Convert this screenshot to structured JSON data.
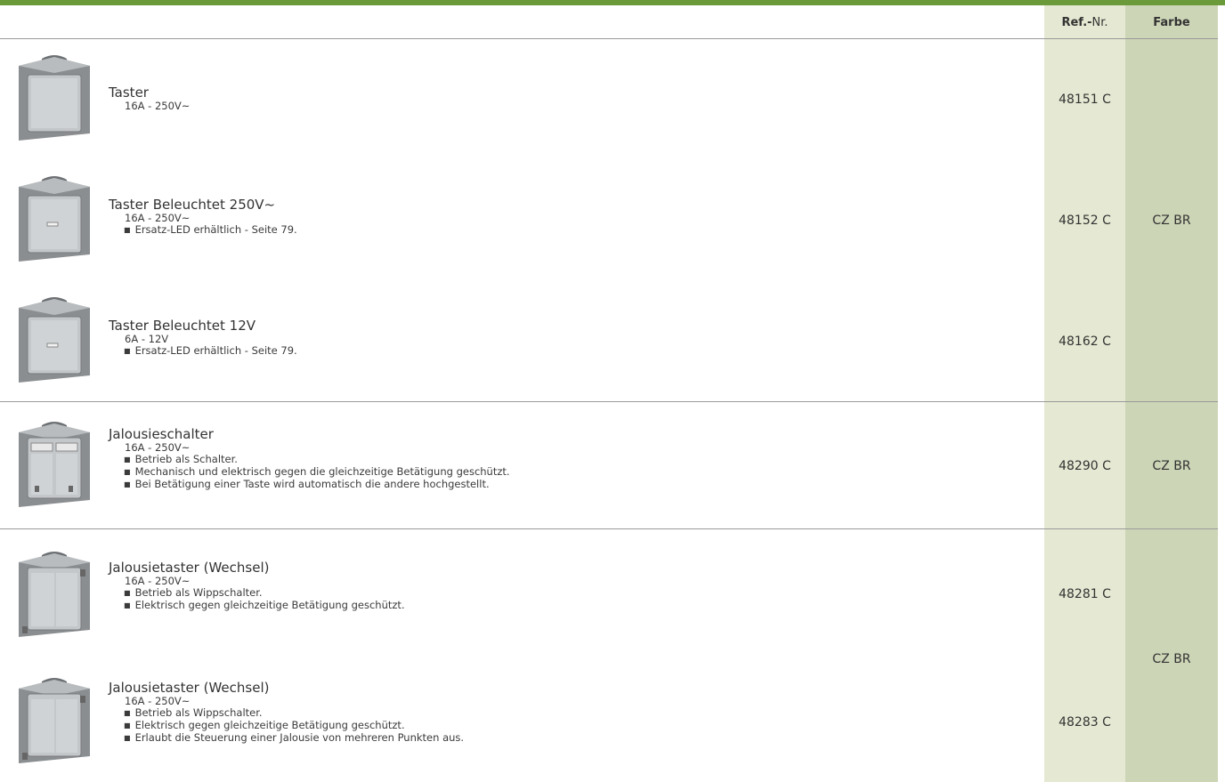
{
  "header": {
    "ref_bold": "Ref.-",
    "ref_rest": "Nr.",
    "farbe": "Farbe"
  },
  "products": [
    {
      "title": "Taster",
      "spec": "16A - 250V~",
      "notes": [],
      "ref": "48151 C",
      "icon": "push-button-switch"
    },
    {
      "title": "Taster Beleuchtet 250V~",
      "spec": "16A - 250V~",
      "notes": [
        "Ersatz-LED erhältlich - Seite 79."
      ],
      "ref": "48152 C",
      "icon": "illuminated-push-button"
    },
    {
      "title": "Taster Beleuchtet 12V",
      "spec": "6A - 12V",
      "notes": [
        "Ersatz-LED erhältlich - Seite 79."
      ],
      "ref": "48162 C",
      "icon": "illuminated-push-button"
    },
    {
      "title": "Jalousieschalter",
      "spec": "16A - 250V~",
      "notes": [
        "Betrieb als Schalter.",
        "Mechanisch und elektrisch gegen die gleichzeitige Betätigung geschützt.",
        "Bei Betätigung einer Taste wird automatisch die andere hochgestellt."
      ],
      "ref": "48290 C",
      "icon": "blind-switch"
    },
    {
      "title": "Jalousietaster (Wechsel)",
      "spec": "16A - 250V~",
      "notes": [
        "Betrieb als Wippschalter.",
        "Elektrisch gegen gleichzeitige Betätigung geschützt."
      ],
      "ref": "48281 C",
      "icon": "blind-push-button"
    },
    {
      "title": "Jalousietaster (Wechsel)",
      "spec": "16A - 250V~",
      "notes": [
        "Betrieb als Wippschalter.",
        "Elektrisch gegen gleichzeitige Betätigung geschützt.",
        "Erlaubt die Steuerung einer Jalousie von mehreren Punkten aus."
      ],
      "ref": "48283 C",
      "icon": "blind-push-button"
    }
  ],
  "colors": [
    "CZ BR",
    "CZ BR",
    "CZ BR"
  ],
  "palette": {
    "accent_bar": "#6a9a3a",
    "ref_column": "#e5e8d2",
    "farbe_column": "#ccd5b6"
  }
}
